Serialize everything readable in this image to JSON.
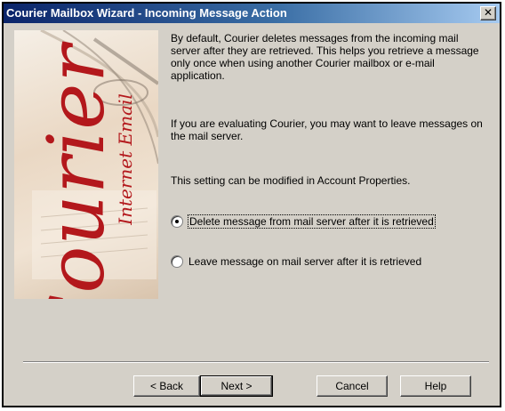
{
  "window": {
    "title": "Courier Mailbox Wizard - Incoming Message Action",
    "close_glyph": "✕"
  },
  "sidebar_image": {
    "logo_main": "Courier",
    "logo_sub": "Internet Email"
  },
  "content": {
    "paragraph1": "By default, Courier deletes messages from the incoming mail server after they are retrieved. This helps you retrieve a message only once when using another Courier mailbox or e-mail application.",
    "paragraph2": "If you are evaluating Courier, you may want to leave messages on the mail server.",
    "paragraph3": "This setting can be modified in Account Properties.",
    "options": [
      {
        "label": "Delete message from mail server after it is retrieved",
        "selected": true
      },
      {
        "label": "Leave message on mail server after it is retrieved",
        "selected": false
      }
    ]
  },
  "buttons": {
    "back": "< Back",
    "next": "Next >",
    "cancel": "Cancel",
    "help": "Help"
  }
}
